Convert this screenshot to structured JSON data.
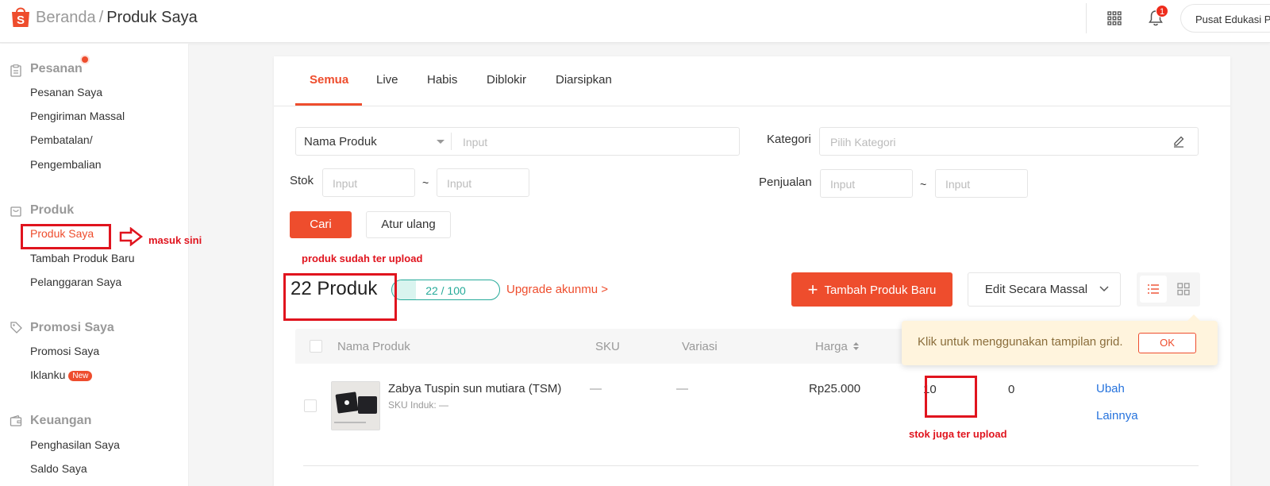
{
  "header": {
    "breadcrumb_home": "Beranda",
    "breadcrumb_sep": "/",
    "breadcrumb_current": "Produk Saya",
    "notification_count": "1",
    "edu_button": "Pusat Edukasi P"
  },
  "sidebar": {
    "sections": [
      {
        "title": "Pesanan",
        "icon": "clipboard-icon",
        "items": [
          "Pesanan Saya",
          "Pengiriman Massal",
          "Pembatalan/",
          "Pengembalian"
        ]
      },
      {
        "title": "Produk",
        "icon": "bag-icon",
        "items": [
          "Produk Saya",
          "Tambah Produk Baru",
          "Pelanggaran Saya"
        ]
      },
      {
        "title": "Promosi Saya",
        "icon": "tag-icon",
        "items": [
          "Promosi Saya",
          "Iklanku"
        ]
      },
      {
        "title": "Keuangan",
        "icon": "wallet-icon",
        "items": [
          "Penghasilan Saya",
          "Saldo Saya"
        ]
      }
    ],
    "new_badge": "New"
  },
  "tabs": [
    "Semua",
    "Live",
    "Habis",
    "Diblokir",
    "Diarsipkan"
  ],
  "filters": {
    "name_select": "Nama Produk",
    "name_placeholder": "Input",
    "category_label": "Kategori",
    "category_placeholder": "Pilih Kategori",
    "stock_label": "Stok",
    "sales_label": "Penjualan",
    "range_placeholder": "Input",
    "tilde": "~",
    "search_button": "Cari",
    "reset_button": "Atur ulang"
  },
  "summary": {
    "count": "22 Produk",
    "quota_text": "22 / 100",
    "quota_fraction": 0.22,
    "upgrade_link": "Upgrade akunmu >",
    "add_button": "Tambah Produk Baru",
    "bulk_edit": "Edit Secara Massal"
  },
  "table": {
    "headers": [
      "Nama Produk",
      "SKU",
      "Variasi",
      "Harga"
    ],
    "rows": [
      {
        "name": "Zabya Tuspin sun mutiara (TSM)",
        "sku_parent": "SKU Induk: —",
        "sku": "—",
        "variation": "—",
        "price": "Rp25.000",
        "stock": "10",
        "sales": "0",
        "action_edit": "Ubah",
        "action_more": "Lainnya"
      }
    ]
  },
  "tooltip": {
    "text": "Klik untuk menggunakan tampilan grid.",
    "ok": "OK"
  },
  "annotations": {
    "enter_here": "masuk sini",
    "product_uploaded": "produk sudah ter upload",
    "stock_uploaded": "stok juga ter upload"
  },
  "colors": {
    "brand": "#ee4d2d",
    "annotation": "#e0141e",
    "link": "#2673dd",
    "quota": "#26aa99"
  }
}
